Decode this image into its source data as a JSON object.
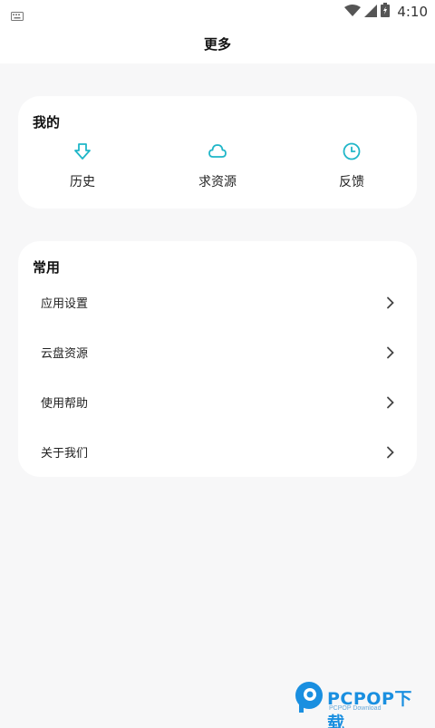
{
  "status_bar": {
    "time": "4:10",
    "icons": [
      "keyboard-icon",
      "wifi-icon",
      "signal-icon",
      "battery-icon"
    ]
  },
  "header": {
    "title": "更多"
  },
  "mine": {
    "title": "我的",
    "items": [
      {
        "label": "历史",
        "icon": "history-download-icon"
      },
      {
        "label": "求资源",
        "icon": "cloud-icon"
      },
      {
        "label": "反馈",
        "icon": "clock-icon"
      }
    ]
  },
  "common": {
    "title": "常用",
    "items": [
      {
        "label": "应用设置"
      },
      {
        "label": "云盘资源"
      },
      {
        "label": "使用帮助"
      },
      {
        "label": "关于我们"
      }
    ]
  },
  "watermark": {
    "text": "PCPOP下载",
    "sub": "PCPOP Download"
  },
  "colors": {
    "accent": "#1fb6c8",
    "background": "#f7f7f8",
    "card": "#ffffff",
    "watermark": "#1a8fe0"
  }
}
